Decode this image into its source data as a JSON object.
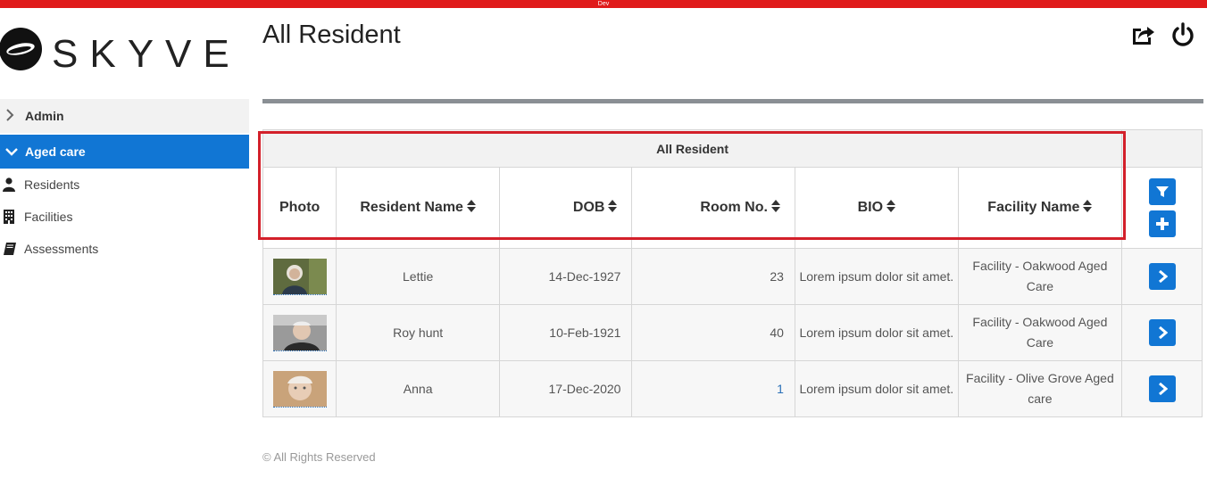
{
  "env_label": "Dev",
  "brand": {
    "name": "SKYVE"
  },
  "sidebar": {
    "groups": [
      {
        "label": "Admin",
        "expanded": false
      },
      {
        "label": "Aged care",
        "expanded": true
      }
    ],
    "items": [
      {
        "label": "Residents",
        "icon": "user-icon"
      },
      {
        "label": "Facilities",
        "icon": "building-icon"
      },
      {
        "label": "Assessments",
        "icon": "book-icon"
      }
    ]
  },
  "header": {
    "title": "All Resident",
    "icons": [
      "share-icon",
      "power-icon"
    ]
  },
  "table": {
    "caption": "All Resident",
    "columns": [
      "Photo",
      "Resident Name",
      "DOB",
      "Room No.",
      "BIO",
      "Facility Name"
    ],
    "rows": [
      {
        "name": "Lettie",
        "dob": "14-Dec-1927",
        "room": "23",
        "bio": "Lorem ipsum dolor sit amet.",
        "facility": "Facility - Oakwood Aged Care"
      },
      {
        "name": "Roy hunt",
        "dob": "10-Feb-1921",
        "room": "40",
        "bio": "Lorem ipsum dolor sit amet.",
        "facility": "Facility - Oakwood Aged Care"
      },
      {
        "name": "Anna",
        "dob": "17-Dec-2020",
        "room": "1",
        "bio": "Lorem ipsum dolor sit amet.",
        "facility": "Facility - Olive Grove Aged care"
      }
    ]
  },
  "footer": "© All Rights Reserved",
  "colors": {
    "accent": "#1176d4",
    "highlight": "#d3202a",
    "devbar": "#e01b1b"
  }
}
